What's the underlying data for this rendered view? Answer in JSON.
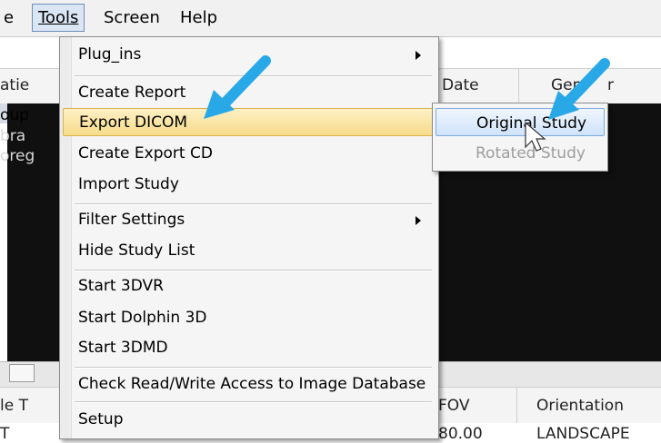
{
  "menubar": {
    "items": [
      {
        "label": "e"
      },
      {
        "label": "Tools"
      },
      {
        "label": "Screen"
      },
      {
        "label": "Help"
      }
    ]
  },
  "background": {
    "header_left": "atie",
    "header_date": "Date",
    "header_gender": "Gen",
    "header_gender_tail": "r",
    "row_fragments": [
      "oup",
      "bra",
      "oreg"
    ],
    "header2_left": "le T",
    "header2_fov": "FOV",
    "header2_orientation": "Orientation",
    "row2_left": "T",
    "row2_fov": "80.00",
    "row2_orientation": "LANDSCAPE"
  },
  "tools_menu": {
    "items": [
      {
        "label": "Plug_ins",
        "submenu": true
      },
      {
        "label": "Create Report"
      },
      {
        "label": "Export DICOM",
        "submenu": true,
        "highlighted": true
      },
      {
        "label": "Create Export CD"
      },
      {
        "label": "Import Study"
      },
      {
        "label": "Filter Settings",
        "submenu": true
      },
      {
        "label": "Hide Study List"
      },
      {
        "label": "Start 3DVR"
      },
      {
        "label": "Start Dolphin 3D"
      },
      {
        "label": "Start 3DMD"
      },
      {
        "label": "Check Read/Write Access to Image Database"
      },
      {
        "label": "Setup"
      }
    ]
  },
  "export_submenu": {
    "items": [
      {
        "label": "Original Study",
        "highlighted": true
      },
      {
        "label": "Rotated Study",
        "disabled": true
      }
    ]
  },
  "colors": {
    "arrow": "#29a8e8",
    "highlight": "#f7dc8a",
    "submenu_highlight": "#cfe3fa"
  }
}
